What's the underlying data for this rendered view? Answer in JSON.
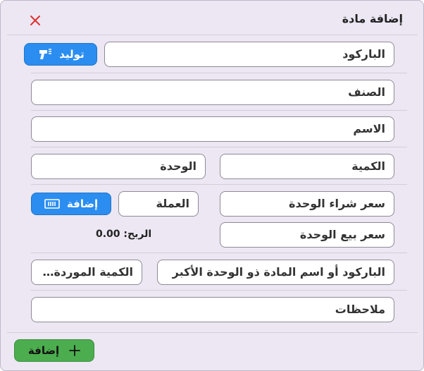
{
  "dialog": {
    "title": "إضافة مادة"
  },
  "fields": {
    "barcode": "الباركود",
    "category": "الصنف",
    "name": "الاسم",
    "quantity": "الكمية",
    "unit": "الوحدة",
    "unit_purchase_price": "سعر شراء الوحدة",
    "currency": "العملة",
    "unit_sale_price": "سعر بيع الوحدة",
    "larger_unit": "الباركود أو اسم المادة ذو الوحدة الأكبر",
    "supplied_quantity": "الكمية الموردة ...",
    "notes": "ملاحظات"
  },
  "buttons": {
    "generate": "توليد",
    "add_currency": "إضافة",
    "add_item": "إضافة"
  },
  "profit": {
    "label": "الربح:",
    "value": "0.00"
  },
  "icons": {
    "close": "close-icon",
    "generate": "barcode-scanner-icon",
    "currency": "money-icon",
    "add": "plus-icon"
  },
  "colors": {
    "primary": "#2b8df0",
    "success": "#4cad4f",
    "danger": "#e0302f"
  }
}
